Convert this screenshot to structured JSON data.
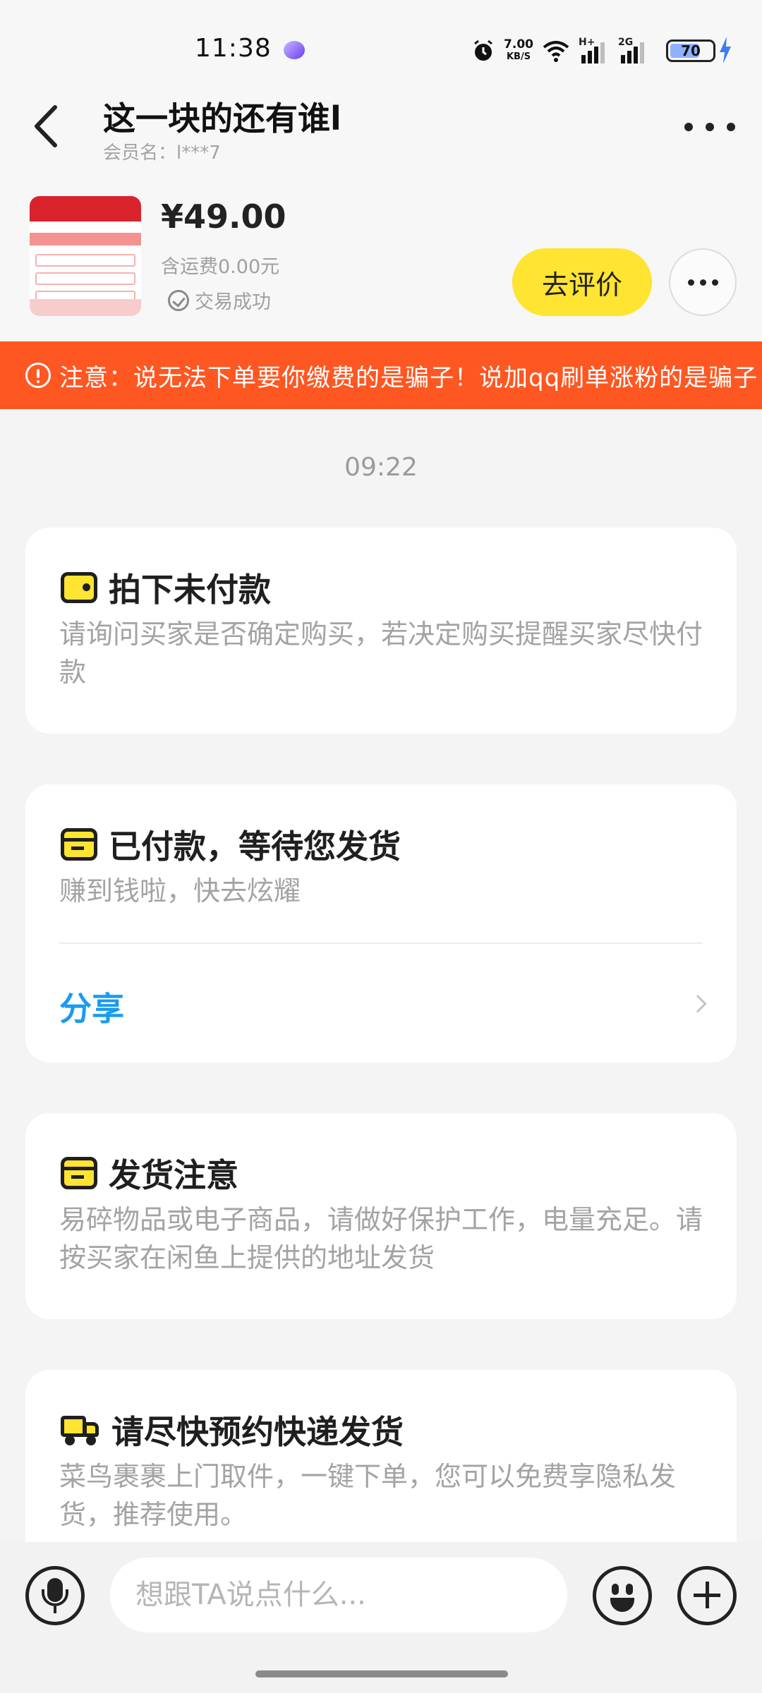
{
  "status_bar": {
    "time": "11:38",
    "net_speed": "7.00",
    "net_unit": "KB/S",
    "signal_1": "H+",
    "signal_2": "2G",
    "battery": "70",
    "icons": [
      "alarm-icon",
      "wifi-icon",
      "signal-icon",
      "signal-icon",
      "battery-icon",
      "charging-icon"
    ]
  },
  "header": {
    "title": "这一块的还有谁l",
    "member": "会员名：l***7"
  },
  "product": {
    "price": "¥49.00",
    "shipping": "含运费0.00元",
    "status": "交易成功",
    "review_button": "去评价"
  },
  "warning": {
    "text": "注意：说无法下单要你缴费的是骗子！说加qq刷单涨粉的是骗子"
  },
  "timestamp": "09:22",
  "cards": [
    {
      "title": "拍下未付款",
      "desc": "请询问买家是否确定购买，若决定购买提醒买家尽快付款"
    },
    {
      "title": "已付款，等待您发货",
      "desc": "赚到钱啦，快去炫耀",
      "action": "分享"
    },
    {
      "title": "发货注意",
      "desc": "易碎物品或电子商品，请做好保护工作，电量充足。请按买家在闲鱼上提供的地址发货"
    },
    {
      "title": "请尽快预约快递发货",
      "desc": "菜鸟裹裹上门取件，一键下单，您可以免费享隐私发货，推荐使用。"
    }
  ],
  "input": {
    "placeholder": "想跟TA说点什么..."
  },
  "colors": {
    "accent_yellow": "#ffe431",
    "warning_orange": "#ff5722",
    "link_blue": "#1a9bf0"
  }
}
